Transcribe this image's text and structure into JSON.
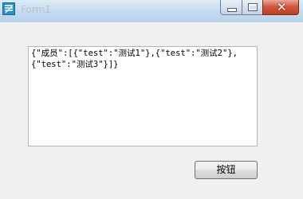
{
  "window": {
    "title": "Form1"
  },
  "titlebar": {
    "minimize_glyph": "",
    "close_glyph": "✕"
  },
  "textarea": {
    "value": "{\"成员\":[{\"test\":\"测试1\"},{\"test\":\"测试2\"},\n{\"test\":\"测试3\"}]}"
  },
  "button": {
    "label": "按钮"
  }
}
